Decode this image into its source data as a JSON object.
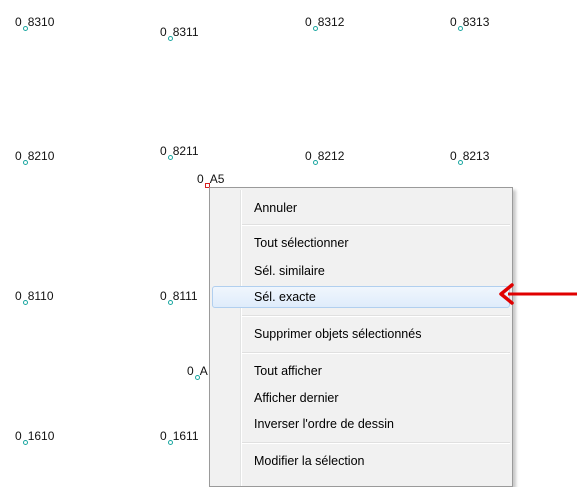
{
  "points": [
    {
      "prefix": "0",
      "suffix": "8310",
      "marker": "circle"
    },
    {
      "prefix": "0",
      "suffix": "8311",
      "marker": "circle"
    },
    {
      "prefix": "0",
      "suffix": "8312",
      "marker": "circle"
    },
    {
      "prefix": "0",
      "suffix": "8313",
      "marker": "circle"
    },
    {
      "prefix": "0",
      "suffix": "8210",
      "marker": "circle"
    },
    {
      "prefix": "0",
      "suffix": "8211",
      "marker": "circle"
    },
    {
      "prefix": "0",
      "suffix": "8212",
      "marker": "circle"
    },
    {
      "prefix": "0",
      "suffix": "8213",
      "marker": "circle"
    },
    {
      "prefix": "0",
      "suffix": "A5",
      "marker": "square"
    },
    {
      "prefix": "0",
      "suffix": "8110",
      "marker": "circle"
    },
    {
      "prefix": "0",
      "suffix": "8111",
      "marker": "circle"
    },
    {
      "prefix": "0",
      "suffix": "A",
      "marker": "circle"
    },
    {
      "prefix": "0",
      "suffix": "1610",
      "marker": "circle"
    },
    {
      "prefix": "0",
      "suffix": "1611",
      "marker": "circle"
    }
  ],
  "context_menu": {
    "items": [
      {
        "label": "Annuler"
      },
      {
        "label": "Tout sélectionner"
      },
      {
        "label": "Sél. similaire"
      },
      {
        "label": "Sél. exacte",
        "highlighted": true
      },
      {
        "label": "Supprimer objets sélectionnés"
      },
      {
        "label": "Tout afficher"
      },
      {
        "label": "Afficher dernier"
      },
      {
        "label": "Inverser l'ordre de dessin"
      },
      {
        "label": "Modifier la sélection"
      }
    ]
  },
  "colors": {
    "point_marker": "#1aa6a0",
    "selected_marker": "#d82020",
    "highlight": "#dfecfb",
    "arrow": "#e00000"
  },
  "annotation_arrow": {
    "icon": "red-arrow-left-icon"
  }
}
